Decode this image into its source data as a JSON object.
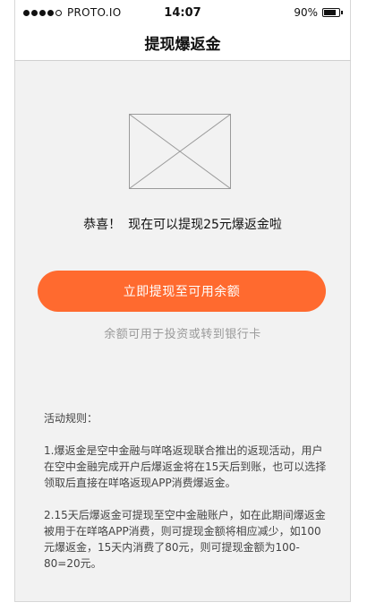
{
  "statusbar": {
    "carrier": "PROTO.IO",
    "time": "14:07",
    "battery": "90%",
    "battery_level": 0.9,
    "signal_dots": [
      true,
      true,
      true,
      true,
      false
    ]
  },
  "navbar": {
    "title": "提现爆返金"
  },
  "main": {
    "image_placeholder": "image-placeholder",
    "congrats_label": "恭喜！",
    "congrats_text": "现在可以提现25元爆返金啦",
    "withdraw_button": "立即提现至可用余额",
    "hint": "余额可用于投资或转到银行卡"
  },
  "rules": {
    "title": "活动规则：",
    "items": [
      "1.爆返金是空中金融与咩咯返现联合推出的返现活动，用户在空中金融完成开户后爆返金将在15天后到账，也可以选择领取后直接在咩咯返现APP消费爆返金。",
      "2.15天后爆返金可提现至空中金融账户，如在此期间爆返金被用于在咩咯APP消费，则可提现金额将相应减少，如100元爆返金，15天内消费了80元，则可提现金额为100-80=20元。"
    ]
  },
  "colors": {
    "accent": "#ff6a2f",
    "background": "#f2f2f2",
    "hint": "#9a9a9a"
  }
}
